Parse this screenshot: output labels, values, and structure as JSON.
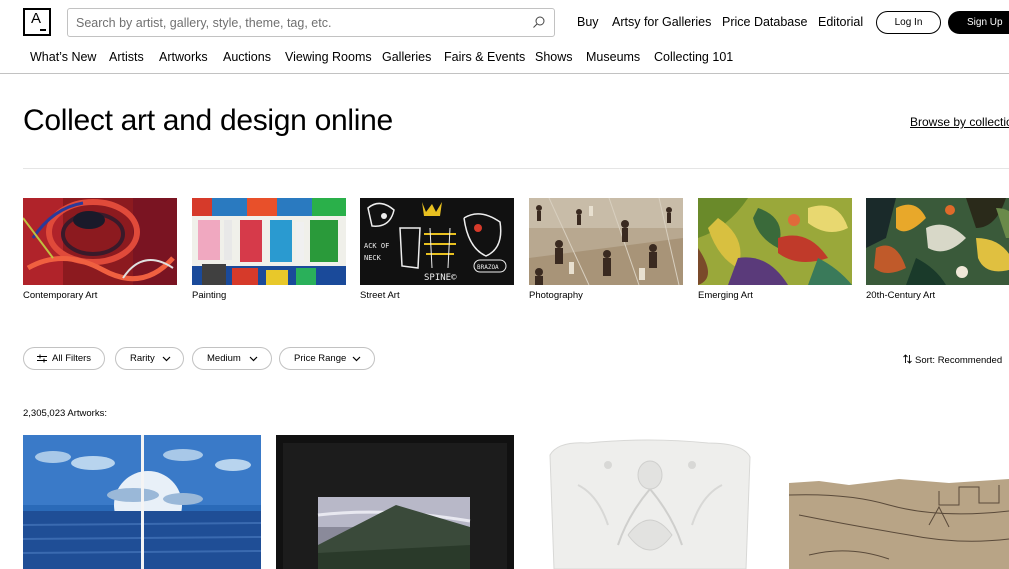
{
  "logo": {
    "letter": "A"
  },
  "search": {
    "placeholder": "Search by artist, gallery, style, theme, tag, etc."
  },
  "top_links": [
    "Buy",
    "Artsy for Galleries",
    "Price Database",
    "Editorial"
  ],
  "auth": {
    "login": "Log In",
    "signup": "Sign Up"
  },
  "nav": [
    "What’s New",
    "Artists",
    "Artworks",
    "Auctions",
    "Viewing Rooms",
    "Galleries",
    "Fairs & Events",
    "Shows",
    "Museums",
    "Collecting 101"
  ],
  "hero": {
    "title": "Collect art and design online",
    "browse_link": "Browse by collections"
  },
  "collections": [
    "Contemporary Art",
    "Painting",
    "Street Art",
    "Photography",
    "Emerging Art",
    "20th-Century Art"
  ],
  "filters": {
    "all_filters": "All Filters",
    "rarity": "Rarity",
    "medium": "Medium",
    "price_range": "Price Range",
    "sort": "Sort: Recommended"
  },
  "results": {
    "count": "2,305,023 Artworks:"
  },
  "street_art_text": {
    "word1": "SPINE©",
    "word2": "ACK OF",
    "word3": "NECK",
    "word4": "BRAZOA"
  },
  "icons": {
    "search": "search-icon",
    "filters": "sliders-icon",
    "sort": "sort-arrows-icon",
    "chevron": "chevron-down-icon"
  }
}
